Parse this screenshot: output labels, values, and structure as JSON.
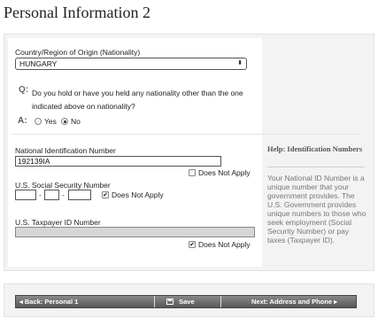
{
  "page": {
    "title": "Personal Information 2"
  },
  "nationality": {
    "label": "Country/Region of Origin (Nationality)",
    "value": "HUNGARY",
    "arrow": "⬍"
  },
  "question": {
    "q_marker": "Q:",
    "text": "Do you hold or have you held any nationality other than the one indicated above on nationality?",
    "a_marker": "A:",
    "yes_label": "Yes",
    "no_label": "No",
    "selected": "No"
  },
  "national_id": {
    "label": "National Identification Number",
    "value": "192139IA",
    "does_not_apply_label": "Does Not Apply",
    "does_not_apply_checked": false
  },
  "ssn": {
    "label": "U.S. Social Security Number",
    "part1": "",
    "part2": "",
    "part3": "",
    "separator": "-",
    "does_not_apply_label": "Does Not Apply",
    "does_not_apply_checked": true,
    "check_glyph": "✔"
  },
  "taxpayer": {
    "label": "U.S. Taxpayer ID Number",
    "value": "",
    "does_not_apply_label": "Does Not Apply",
    "does_not_apply_checked": true,
    "check_glyph": "✔"
  },
  "help": {
    "title": "Help: Identification Numbers",
    "body": "Your National ID Number is a unique number that your government provides. The U.S. Government provides unique numbers to those who seek employment (Social Security Number) or pay taxes (Taxpayer ID)."
  },
  "nav": {
    "back_label": "Back: Personal 1",
    "back_arrow": "◂",
    "save_label": "Save",
    "next_label": "Next: Address and Phone",
    "next_arrow": "▸"
  }
}
